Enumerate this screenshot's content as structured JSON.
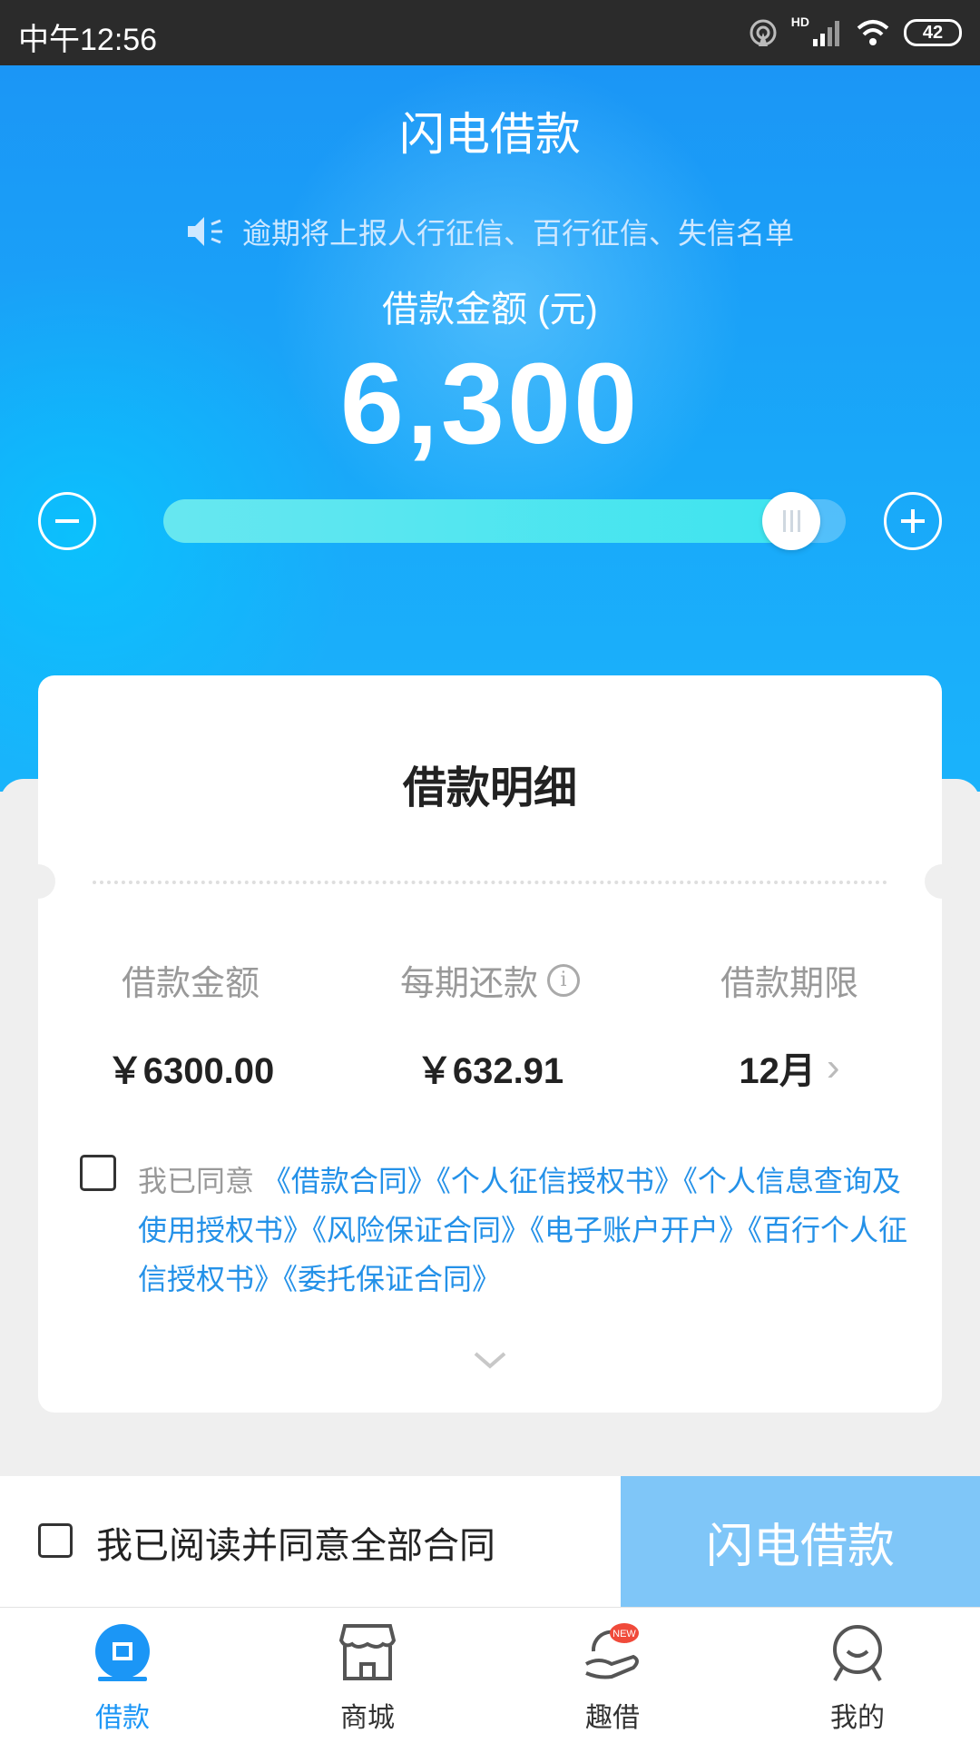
{
  "status_bar": {
    "time": "中午12:56",
    "battery": "42",
    "network": "HD"
  },
  "hero": {
    "title": "闪电借款",
    "notice": "逾期将上报人行征信、百行征信、失信名单",
    "amount_label": "借款金额 (元)",
    "amount_value": "6,300",
    "slider": {
      "fraction": 0.96
    }
  },
  "card": {
    "title": "借款明细",
    "columns": [
      {
        "label": "借款金额",
        "value": "￥6300.00"
      },
      {
        "label": "每期还款",
        "value": "￥632.91"
      },
      {
        "label": "借款期限",
        "value": "12月"
      }
    ],
    "agreement": {
      "prefix": "我已同意",
      "links": "《借款合同》《个人征信授权书》《个人信息查询及使用授权书》《风险保证合同》《电子账户开户》《百行个人征信授权书》《委托保证合同》"
    }
  },
  "action_bar": {
    "agree_all": "我已阅读并同意全部合同",
    "submit": "闪电借款"
  },
  "tabs": [
    {
      "label": "借款",
      "icon": "loan-icon",
      "active": true
    },
    {
      "label": "商城",
      "icon": "store-icon",
      "active": false
    },
    {
      "label": "趣借",
      "icon": "fun-loan-icon",
      "active": false,
      "badge": "NEW"
    },
    {
      "label": "我的",
      "icon": "profile-icon",
      "active": false
    }
  ],
  "colors": {
    "primary": "#1b96f6",
    "link": "#2491e8",
    "button_disabled": "#7fc6f8"
  }
}
